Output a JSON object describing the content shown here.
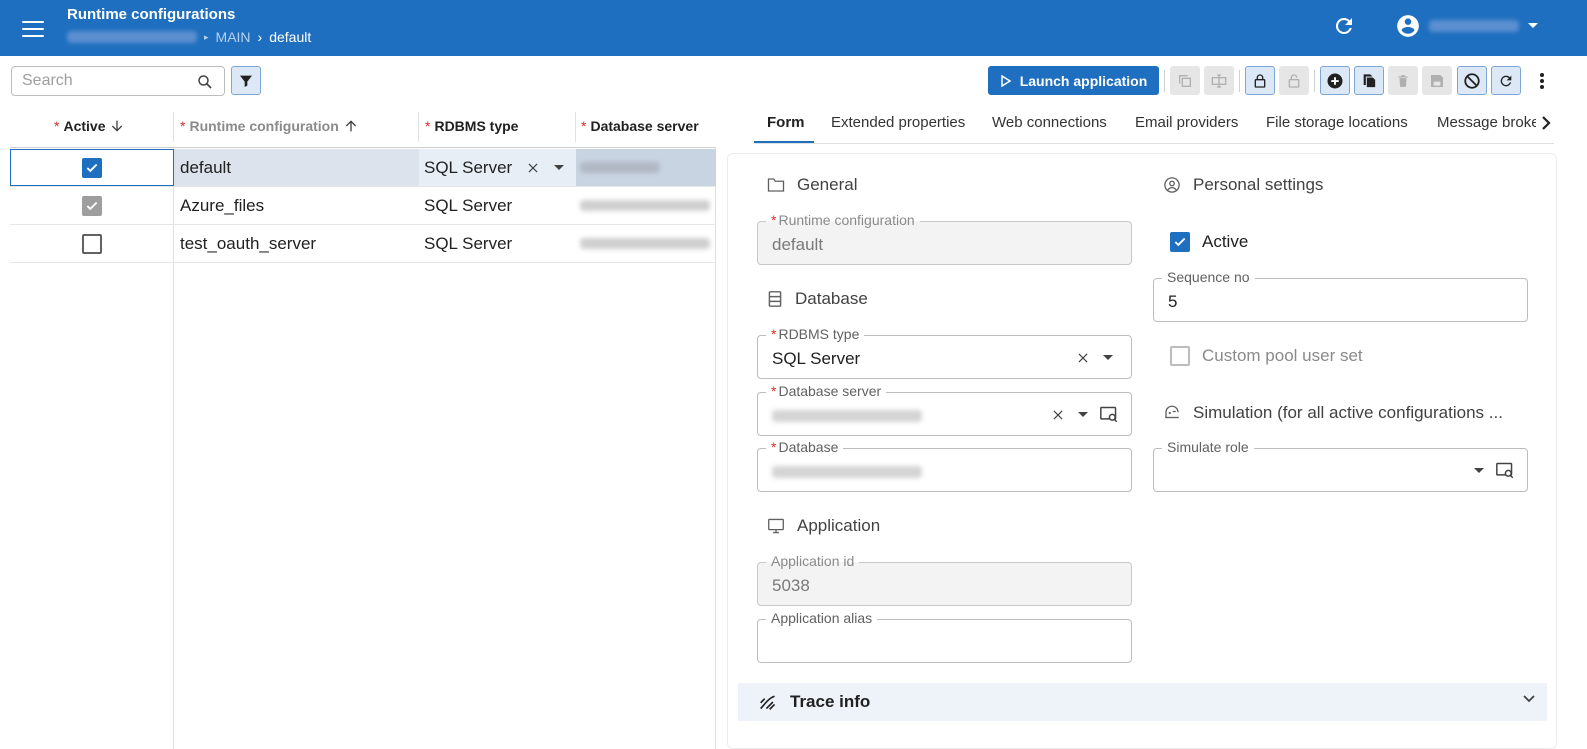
{
  "header": {
    "app_title": "Runtime configurations",
    "breadcrumb": {
      "main": "MAIN",
      "current": "default"
    }
  },
  "toolbar": {
    "search_placeholder": "Search",
    "launch_label": "Launch application"
  },
  "grid": {
    "columns": [
      {
        "label": "Active",
        "required": true,
        "sort": "desc"
      },
      {
        "label": "Runtime configuration",
        "required": true,
        "sort": "asc"
      },
      {
        "label": "RDBMS type",
        "required": true
      },
      {
        "label": "Database server",
        "required": true
      }
    ],
    "rows": [
      {
        "active": true,
        "runtime_configuration": "default",
        "rdbms_type": "SQL Server",
        "selected": true
      },
      {
        "active": true,
        "runtime_configuration": "Azure_files",
        "rdbms_type": "SQL Server",
        "selected": false
      },
      {
        "active": false,
        "runtime_configuration": "test_oauth_server",
        "rdbms_type": "SQL Server",
        "selected": false
      }
    ]
  },
  "tabs": [
    {
      "label": "Form",
      "active": true
    },
    {
      "label": "Extended properties"
    },
    {
      "label": "Web connections"
    },
    {
      "label": "Email providers"
    },
    {
      "label": "File storage locations"
    },
    {
      "label": "Message broke"
    }
  ],
  "form": {
    "general": {
      "title": "General",
      "runtime_configuration_label": "Runtime configuration",
      "runtime_configuration_value": "default"
    },
    "database": {
      "title": "Database",
      "rdbms_type_label": "RDBMS type",
      "rdbms_type_value": "SQL Server",
      "database_server_label": "Database server",
      "database_label": "Database"
    },
    "application": {
      "title": "Application",
      "application_id_label": "Application id",
      "application_id_value": "5038",
      "application_alias_label": "Application alias",
      "application_alias_value": ""
    },
    "personal": {
      "title": "Personal settings",
      "active_label": "Active",
      "active_checked": true,
      "sequence_no_label": "Sequence no",
      "sequence_no_value": "5",
      "custom_pool_label": "Custom pool user set",
      "custom_pool_checked": false
    },
    "simulation": {
      "title": "Simulation (for all active configurations ...",
      "simulate_role_label": "Simulate role",
      "simulate_role_value": ""
    },
    "trace": {
      "title": "Trace info"
    }
  },
  "colors": {
    "brand_blue": "#1e6fbf",
    "required_red": "#d32f2f"
  }
}
